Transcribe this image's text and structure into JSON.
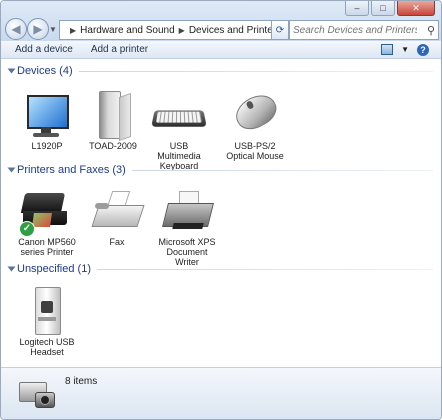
{
  "window": {
    "caption_buttons": [
      "minimize",
      "maximize",
      "close"
    ]
  },
  "navigation": {
    "back_icon": "back-arrow-icon",
    "forward_icon": "forward-arrow-icon"
  },
  "address_bar": {
    "breadcrumbs": [
      "Hardware and Sound",
      "Devices and Printers"
    ]
  },
  "search": {
    "placeholder": "Search Devices and Printers"
  },
  "command_bar": {
    "add_device_label": "Add a device",
    "add_printer_label": "Add a printer"
  },
  "groups": {
    "devices": {
      "title": "Devices (4)",
      "items": [
        {
          "label": "L1920P",
          "icon": "monitor-icon"
        },
        {
          "label": "TOAD-2009",
          "icon": "computer-tower-icon"
        },
        {
          "label": "USB Multimedia Keyboard",
          "icon": "keyboard-icon"
        },
        {
          "label": "USB-PS/2 Optical Mouse",
          "icon": "mouse-icon"
        }
      ]
    },
    "printers": {
      "title": "Printers and Faxes (3)",
      "items": [
        {
          "label": "Canon MP560 series Printer",
          "icon": "printer-icon",
          "default": true
        },
        {
          "label": "Fax",
          "icon": "fax-icon"
        },
        {
          "label": "Microsoft XPS Document Writer",
          "icon": "xps-printer-icon"
        }
      ]
    },
    "unspecified": {
      "title": "Unspecified (1)",
      "items": [
        {
          "label": "Logitech USB Headset",
          "icon": "headset-box-icon"
        }
      ]
    }
  },
  "status_bar": {
    "item_count": "8 items",
    "icon": "printer-camera-icon"
  },
  "colors": {
    "group_title": "#1e3a8a",
    "chrome": "#c9daee"
  }
}
